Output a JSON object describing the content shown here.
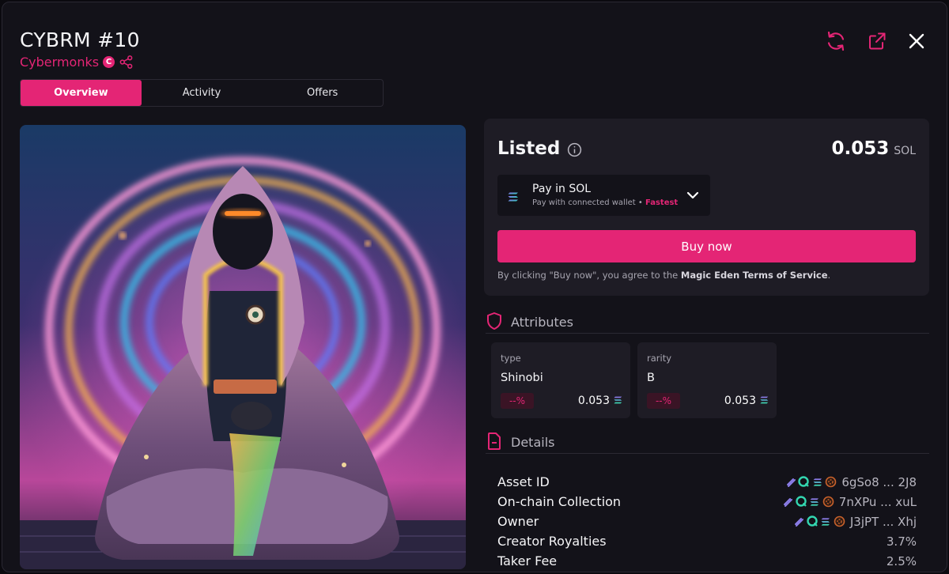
{
  "header": {
    "title": "CYBRM #10",
    "collection": "Cybermonks",
    "collection_badge": "C"
  },
  "tabs": [
    {
      "label": "Overview",
      "active": true
    },
    {
      "label": "Activity",
      "active": false
    },
    {
      "label": "Offers",
      "active": false
    }
  ],
  "listing": {
    "status": "Listed",
    "price": "0.053",
    "currency": "SOL",
    "pay_title": "Pay in SOL",
    "pay_subtitle": "Pay with connected wallet",
    "pay_separator": "•",
    "pay_speed": "Fastest",
    "buy_label": "Buy now",
    "terms_prefix": "By clicking \"Buy now\", you agree to the ",
    "terms_link": "Magic Eden Terms of Service",
    "terms_suffix": "."
  },
  "attributes": {
    "heading": "Attributes",
    "items": [
      {
        "type": "type",
        "value": "Shinobi",
        "pct": "--%",
        "price": "0.053"
      },
      {
        "type": "rarity",
        "value": "B",
        "pct": "--%",
        "price": "0.053"
      }
    ]
  },
  "details": {
    "heading": "Details",
    "rows": [
      {
        "label": "Asset ID",
        "value": "6gSo8 ... 2J8",
        "has_chain_icons": true
      },
      {
        "label": "On-chain Collection",
        "value": "7nXPu ... xuL",
        "has_chain_icons": true
      },
      {
        "label": "Owner",
        "value": "J3jPT ... Xhj",
        "has_chain_icons": true
      },
      {
        "label": "Creator Royalties",
        "value": "3.7%",
        "has_chain_icons": false
      },
      {
        "label": "Taker Fee",
        "value": "2.5%",
        "has_chain_icons": false
      }
    ]
  },
  "colors": {
    "accent": "#e42575",
    "panel": "#1e1c25",
    "background": "#131219"
  },
  "icons": [
    "refresh-icon",
    "external-link-icon",
    "close-icon",
    "share-icon",
    "info-icon",
    "chevron-down-icon",
    "shield-icon",
    "document-icon",
    "solana-icon"
  ]
}
